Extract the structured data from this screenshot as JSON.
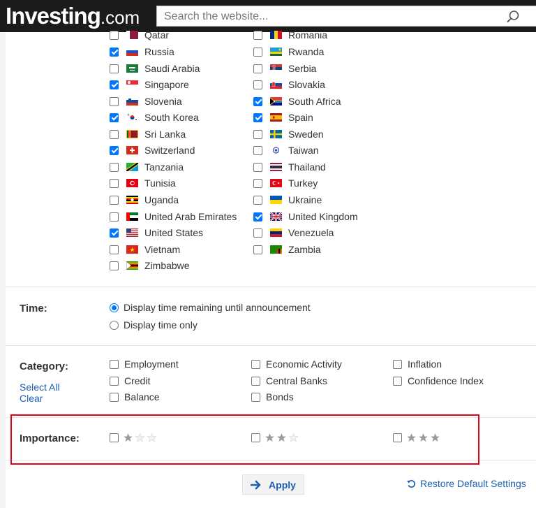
{
  "header": {
    "logo_main": "Investing",
    "logo_suffix": ".com",
    "search_placeholder": "Search the website..."
  },
  "countries": {
    "left": [
      {
        "name": "Qatar",
        "checked": false,
        "flag": "qatar-flag"
      },
      {
        "name": "Russia",
        "checked": true,
        "flag": "russia-flag"
      },
      {
        "name": "Saudi Arabia",
        "checked": false,
        "flag": "saudi-arabia-flag"
      },
      {
        "name": "Singapore",
        "checked": true,
        "flag": "singapore-flag"
      },
      {
        "name": "Slovenia",
        "checked": false,
        "flag": "slovenia-flag"
      },
      {
        "name": "South Korea",
        "checked": true,
        "flag": "south-korea-flag"
      },
      {
        "name": "Sri Lanka",
        "checked": false,
        "flag": "sri-lanka-flag"
      },
      {
        "name": "Switzerland",
        "checked": true,
        "flag": "switzerland-flag"
      },
      {
        "name": "Tanzania",
        "checked": false,
        "flag": "tanzania-flag"
      },
      {
        "name": "Tunisia",
        "checked": false,
        "flag": "tunisia-flag"
      },
      {
        "name": "Uganda",
        "checked": false,
        "flag": "uganda-flag"
      },
      {
        "name": "United Arab Emirates",
        "checked": false,
        "flag": "uae-flag"
      },
      {
        "name": "United States",
        "checked": true,
        "flag": "united-states-flag"
      },
      {
        "name": "Vietnam",
        "checked": false,
        "flag": "vietnam-flag"
      },
      {
        "name": "Zimbabwe",
        "checked": false,
        "flag": "zimbabwe-flag"
      }
    ],
    "right": [
      {
        "name": "Romania",
        "checked": false,
        "flag": "romania-flag"
      },
      {
        "name": "Rwanda",
        "checked": false,
        "flag": "rwanda-flag"
      },
      {
        "name": "Serbia",
        "checked": false,
        "flag": "serbia-flag"
      },
      {
        "name": "Slovakia",
        "checked": false,
        "flag": "slovakia-flag"
      },
      {
        "name": "South Africa",
        "checked": true,
        "flag": "south-africa-flag"
      },
      {
        "name": "Spain",
        "checked": true,
        "flag": "spain-flag"
      },
      {
        "name": "Sweden",
        "checked": false,
        "flag": "sweden-flag"
      },
      {
        "name": "Taiwan",
        "checked": false,
        "flag": "taiwan-flag"
      },
      {
        "name": "Thailand",
        "checked": false,
        "flag": "thailand-flag"
      },
      {
        "name": "Turkey",
        "checked": false,
        "flag": "turkey-flag"
      },
      {
        "name": "Ukraine",
        "checked": false,
        "flag": "ukraine-flag"
      },
      {
        "name": "United Kingdom",
        "checked": true,
        "flag": "united-kingdom-flag"
      },
      {
        "name": "Venezuela",
        "checked": false,
        "flag": "venezuela-flag"
      },
      {
        "name": "Zambia",
        "checked": false,
        "flag": "zambia-flag"
      }
    ]
  },
  "time": {
    "label": "Time:",
    "options": [
      {
        "label": "Display time remaining until announcement",
        "selected": true
      },
      {
        "label": "Display time only",
        "selected": false
      }
    ]
  },
  "category": {
    "label": "Category:",
    "select_all": "Select All",
    "clear": "Clear",
    "items": [
      {
        "label": "Employment",
        "checked": false
      },
      {
        "label": "Economic Activity",
        "checked": false
      },
      {
        "label": "Inflation",
        "checked": false
      },
      {
        "label": "Credit",
        "checked": false
      },
      {
        "label": "Central Banks",
        "checked": false
      },
      {
        "label": "Confidence Index",
        "checked": false
      },
      {
        "label": "Balance",
        "checked": false
      },
      {
        "label": "Bonds",
        "checked": false
      }
    ]
  },
  "importance": {
    "label": "Importance:",
    "levels": [
      {
        "stars": 1,
        "max": 3,
        "checked": false
      },
      {
        "stars": 2,
        "max": 3,
        "checked": false
      },
      {
        "stars": 3,
        "max": 3,
        "checked": false
      }
    ]
  },
  "actions": {
    "apply": "Apply",
    "restore": "Restore Default Settings"
  },
  "colors": {
    "link": "#1c5fb1",
    "checkbox_checked": "#0075ff",
    "highlight_border": "#e2001a",
    "header_bg": "#1b1b1b"
  }
}
